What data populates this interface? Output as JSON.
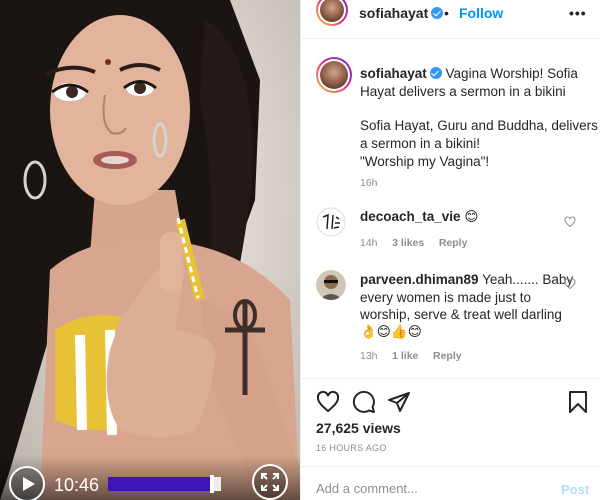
{
  "video": {
    "time": "10:46",
    "progress": 0.9,
    "play_icon": "play-icon",
    "fullscreen_icon": "fullscreen-icon"
  },
  "post": {
    "username": "sofiahayat",
    "follow_label": "Follow",
    "dot": "•",
    "more_label": "•••",
    "caption": {
      "title_text": "Vagina Worship! Sofia",
      "title_text_2": "Hayat delivers a sermon in a bikini",
      "body_line1": "Sofia Hayat, Guru and Buddha, delivers",
      "body_line2": "a sermon in a bikini!",
      "body_line3": "\"Worship my Vagina\"!",
      "time": "16h"
    },
    "comments": [
      {
        "username": "decoach_ta_vie",
        "text": "😊",
        "time": "14h",
        "likes": "3 likes",
        "reply": "Reply"
      },
      {
        "username": "parveen.dhiman89",
        "text_line1": "Yeah....... Baby",
        "text_line2": "every women is made just to",
        "text_line3": "worship, serve & treat well darling",
        "text_line4": "👌😊👍😊",
        "time": "13h",
        "likes": "1 like",
        "reply": "Reply"
      }
    ],
    "likes_count": "27,625 views",
    "posted": "16 HOURS AGO",
    "comment_placeholder": "Add a comment...",
    "post_label": "Post"
  },
  "colors": {
    "accent": "#0095f6",
    "progress": "#3b16b4",
    "verified": "#3897f0"
  }
}
